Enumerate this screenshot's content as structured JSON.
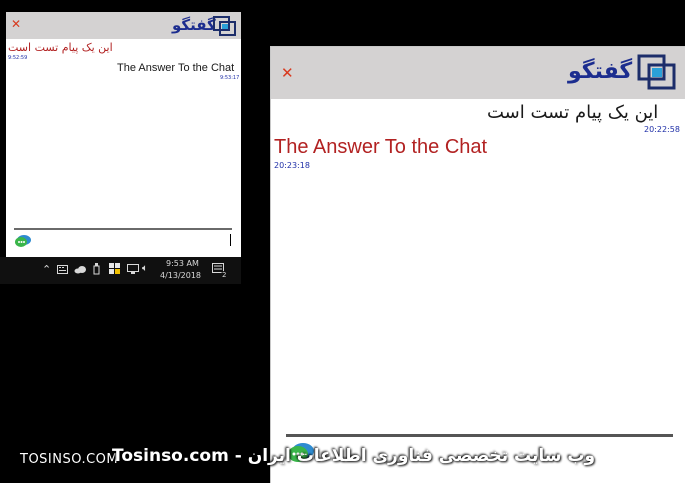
{
  "small_window": {
    "title": "گفتگو",
    "close_glyph": "✕",
    "messages": [
      {
        "text": "این یک پیام تست است",
        "time": "9:52:59",
        "color": "#b22222"
      },
      {
        "text": "The Answer To the Chat",
        "time": "9:53:17",
        "color": "#1a1a1a"
      }
    ]
  },
  "taskbar": {
    "clock_time": "9:53 AM",
    "clock_date": "4/13/2018",
    "notification_count": "2",
    "icons": [
      "chevron-up-icon",
      "keyboard-icon",
      "cloud-icon",
      "usb-icon",
      "shield-flag-icon",
      "network-icon",
      "volume-icon",
      "notification-icon"
    ]
  },
  "big_window": {
    "title": "گفتگو",
    "close_glyph": "✕",
    "messages": [
      {
        "text": "این یک پیام تست است",
        "time": "20:22:58",
        "color": "#1a1a1a"
      },
      {
        "text": "The Answer To the Chat",
        "time": "20:23:18",
        "color": "#b22222"
      }
    ]
  },
  "watermark": {
    "left": "TOSINSO.COM",
    "main": "Tosinso.com - وب سایت تخصصی فناوری اطلاعات ایران"
  },
  "colors": {
    "header_bg": "#d4d2d2",
    "title": "#1c2d8f",
    "close": "#d83a1f",
    "timestamp": "#2030a8"
  }
}
